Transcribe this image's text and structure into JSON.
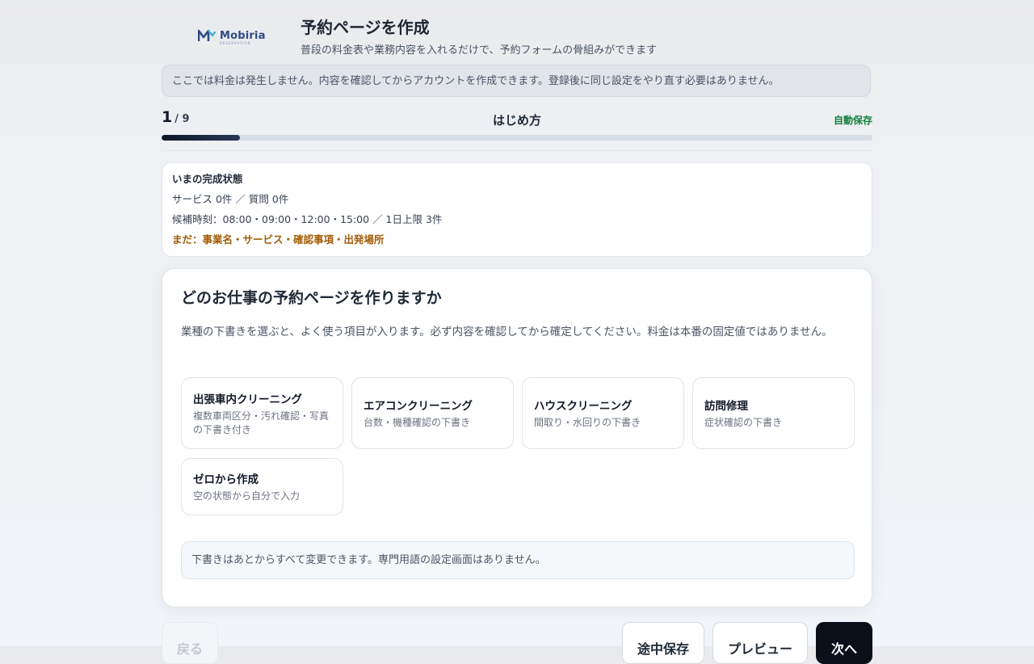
{
  "brand": {
    "name": "Mobiria",
    "tagline": "RESERVATION",
    "color": "#2f4a86"
  },
  "header": {
    "title": "予約ページを作成",
    "subtitle": "普段の料金表や業務内容を入れるだけで、予約フォームの骨組みができます"
  },
  "notice": "ここでは料金は発生しません。内容を確認してからアカウントを作成できます。登録後に同じ設定をやり直す必要はありません。",
  "step": {
    "current": "1",
    "total": "/ 9",
    "name": "はじめ方",
    "autosave": "自動保存",
    "progress": 0.11
  },
  "status": {
    "heading": "いまの完成状態",
    "counts": "サービス 0件 ／ 質問 0件",
    "slots": "候補時刻：08:00・09:00・12:00・15:00 ／ 1日上限 3件",
    "missing": "まだ：事業名・サービス・確認事項・出発場所"
  },
  "question": {
    "title": "どのお仕事の予約ページを作りますか",
    "description": "業種の下書きを選ぶと、よく使う項目が入ります。必ず内容を確認してから確定してください。料金は本番の固定値ではありません。",
    "options": [
      {
        "title": "出張車内クリーニング",
        "desc": "複数車両区分・汚れ確認・写真の下書き付き"
      },
      {
        "title": "エアコンクリーニング",
        "desc": "台数・機種確認の下書き"
      },
      {
        "title": "ハウスクリーニング",
        "desc": "間取り・水回りの下書き"
      },
      {
        "title": "訪問修理",
        "desc": "症状確認の下書き"
      },
      {
        "title": "ゼロから作成",
        "desc": "空の状態から自分で入力"
      }
    ],
    "tip": "下書きはあとからすべて変更できます。専門用語の設定画面はありません。"
  },
  "footer": {
    "back": "戻る",
    "save": "途中保存",
    "preview": "プレビュー",
    "next": "次へ"
  },
  "colors": {
    "accent": "#0b0f19",
    "success": "#15803d",
    "warning": "#a15c07"
  }
}
